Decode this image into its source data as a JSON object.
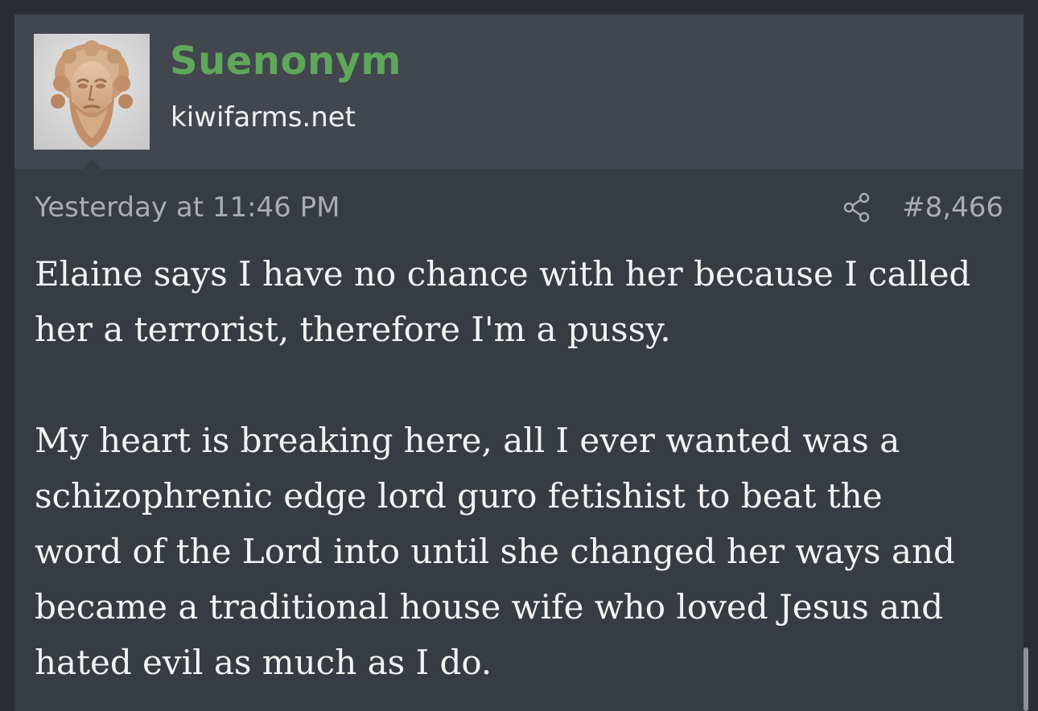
{
  "user": {
    "name": "Suenonym",
    "title": "kiwifarms.net",
    "avatar_icon": "bust-avatar"
  },
  "post": {
    "timestamp": "Yesterday at 11:46 PM",
    "share_icon": "share-icon",
    "number": "#8,466",
    "paragraphs": [
      "Elaine says I have no chance with her because I called\nher a terrorist, therefore I'm a pussy.",
      "My heart is breaking here, all I ever wanted was a\nschizophrenic edge lord guro fetishist to beat the\nword of the Lord into until she changed her ways and\nbecame a traditional house wife who loved Jesus and\nhated evil as much as I do."
    ]
  },
  "colors": {
    "background": "#2a2d33",
    "post_body": "#373b42",
    "post_header": "#42464e",
    "username": "#5fa75a",
    "meta": "#a9adb3",
    "text": "#f3f3f3"
  }
}
